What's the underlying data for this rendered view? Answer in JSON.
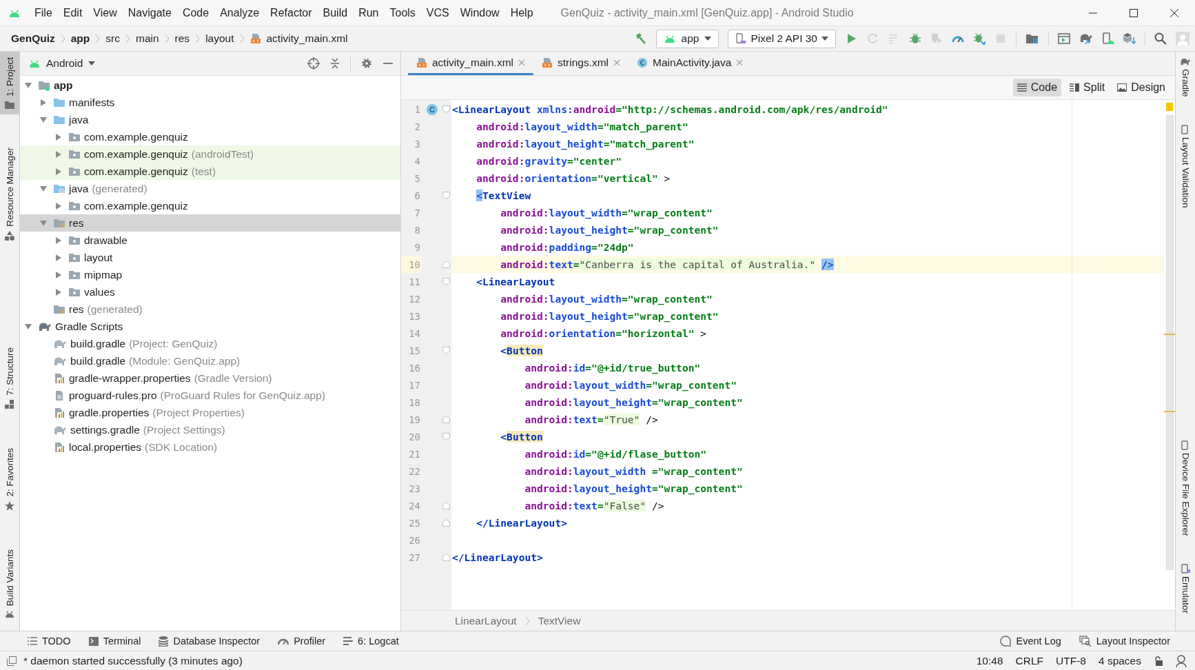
{
  "window": {
    "title": "GenQuiz - activity_main.xml [GenQuiz.app] - Android Studio"
  },
  "menu": [
    "File",
    "Edit",
    "View",
    "Navigate",
    "Code",
    "Analyze",
    "Refactor",
    "Build",
    "Run",
    "Tools",
    "VCS",
    "Window",
    "Help"
  ],
  "breadcrumbs": [
    {
      "label": "GenQuiz",
      "bold": true,
      "kind": "plain"
    },
    {
      "label": "app",
      "bold": true,
      "kind": "plain"
    },
    {
      "label": "src",
      "bold": false,
      "kind": "plain"
    },
    {
      "label": "main",
      "bold": false,
      "kind": "plain"
    },
    {
      "label": "res",
      "bold": false,
      "kind": "plain"
    },
    {
      "label": "layout",
      "bold": false,
      "kind": "plain"
    },
    {
      "label": "activity_main.xml",
      "bold": false,
      "kind": "xml"
    }
  ],
  "run_config": "app",
  "device": "Pixel 2 API 30",
  "toolbar_actions": [
    {
      "kind": "run",
      "disabled": false
    },
    {
      "kind": "rerun",
      "disabled": true
    },
    {
      "kind": "apply",
      "disabled": true
    },
    {
      "kind": "debug",
      "disabled": false
    },
    {
      "kind": "coverage",
      "disabled": true
    },
    {
      "kind": "profile",
      "disabled": false
    },
    {
      "kind": "attach",
      "disabled": false
    },
    {
      "kind": "stop",
      "disabled": true
    },
    {
      "kind": "structure",
      "disabled": false
    },
    {
      "kind": "layout",
      "disabled": false
    },
    {
      "kind": "sync",
      "disabled": false
    },
    {
      "kind": "avd",
      "disabled": false
    },
    {
      "kind": "sdk",
      "disabled": false
    }
  ],
  "left_stripe": {
    "top": [
      {
        "label": "1: Project",
        "selected": true,
        "kind": "folder"
      },
      {
        "label": "Resource Manager",
        "selected": false,
        "kind": "shapes"
      }
    ],
    "bottom": [
      {
        "label": "7: Structure",
        "selected": false,
        "kind": "structure"
      },
      {
        "label": "2: Favorites",
        "selected": false,
        "kind": "star"
      },
      {
        "label": "Build Variants",
        "selected": false,
        "kind": "android"
      }
    ]
  },
  "right_stripe": {
    "top": [
      {
        "label": "Gradle",
        "kind": "gradle"
      },
      {
        "label": "Layout Validation",
        "kind": "validation"
      }
    ],
    "bottom": [
      {
        "label": "Device File Explorer",
        "kind": "device"
      },
      {
        "label": "Emulator",
        "kind": "emulator"
      }
    ]
  },
  "project_panel": {
    "view": "Android",
    "tree": [
      {
        "label": "app",
        "kind": "module",
        "expanded": true,
        "selected": false,
        "children": [
          {
            "label": "manifests",
            "kind": "folder",
            "expanded": false,
            "selected": false
          },
          {
            "label": "java",
            "kind": "folder",
            "expanded": true,
            "selected": false,
            "children": [
              {
                "label": "com.example.genquiz",
                "kind": "package",
                "expanded": false,
                "selected": false,
                "test_source": false
              },
              {
                "label": "com.example.genquiz",
                "note": "(androidTest)",
                "kind": "package",
                "expanded": false,
                "selected": false,
                "test_source": true
              },
              {
                "label": "com.example.genquiz",
                "note": "(test)",
                "kind": "package",
                "expanded": false,
                "selected": false,
                "test_source": true
              }
            ]
          },
          {
            "label": "java",
            "note": "(generated)",
            "kind": "generated",
            "expanded": true,
            "selected": false,
            "children": [
              {
                "label": "com.example.genquiz",
                "kind": "package",
                "expanded": false,
                "selected": false,
                "test_source": false
              }
            ]
          },
          {
            "label": "res",
            "kind": "res",
            "expanded": true,
            "selected": true,
            "children": [
              {
                "label": "drawable",
                "kind": "package",
                "expanded": false,
                "selected": false
              },
              {
                "label": "layout",
                "kind": "package",
                "expanded": false,
                "selected": false
              },
              {
                "label": "mipmap",
                "kind": "package",
                "expanded": false,
                "selected": false
              },
              {
                "label": "values",
                "kind": "package",
                "expanded": false,
                "selected": false
              }
            ]
          },
          {
            "label": "res",
            "note": "(generated)",
            "kind": "res",
            "selected": false
          }
        ]
      },
      {
        "label": "Gradle Scripts",
        "kind": "gradle",
        "expanded": true,
        "selected": false,
        "children": [
          {
            "label": "build.gradle",
            "note": "(Project: GenQuiz)",
            "kind": "gradle-file",
            "selected": false
          },
          {
            "label": "build.gradle",
            "note": "(Module: GenQuiz.app)",
            "kind": "gradle-file",
            "selected": false
          },
          {
            "label": "gradle-wrapper.properties",
            "note": "(Gradle Version)",
            "kind": "properties",
            "selected": false
          },
          {
            "label": "proguard-rules.pro",
            "note": "(ProGuard Rules for GenQuiz.app)",
            "kind": "text-file",
            "selected": false
          },
          {
            "label": "gradle.properties",
            "note": "(Project Properties)",
            "kind": "properties",
            "selected": false
          },
          {
            "label": "settings.gradle",
            "note": "(Project Settings)",
            "kind": "gradle-file",
            "selected": false
          },
          {
            "label": "local.properties",
            "note": "(SDK Location)",
            "kind": "properties",
            "selected": false
          }
        ]
      }
    ]
  },
  "editor_tabs": [
    {
      "label": "activity_main.xml",
      "kind": "xml",
      "selected": true
    },
    {
      "label": "strings.xml",
      "kind": "xml",
      "selected": false
    },
    {
      "label": "MainActivity.java",
      "kind": "class",
      "selected": false
    }
  ],
  "view_modes": [
    {
      "label": "Code",
      "kind": "code",
      "selected": true
    },
    {
      "label": "Split",
      "kind": "split",
      "selected": false
    },
    {
      "label": "Design",
      "kind": "design",
      "selected": false
    }
  ],
  "code_lines": [
    {
      "number": "1",
      "current": false,
      "badge": "C",
      "fold_start": true,
      "tokens": [
        {
          "kind": "tag",
          "text": "<LinearLayout "
        },
        {
          "kind": "attr",
          "text": "xmlns:"
        },
        {
          "kind": "ns",
          "text": "android"
        },
        {
          "kind": "value",
          "text": "=\"http://schemas.android.com/apk/res/android\""
        }
      ]
    },
    {
      "number": "2",
      "current": false,
      "tokens": [
        {
          "kind": "ns",
          "text": "    android:"
        },
        {
          "kind": "attr",
          "text": "layout_width"
        },
        {
          "kind": "value",
          "text": "=\"match_parent\""
        }
      ]
    },
    {
      "number": "3",
      "current": false,
      "tokens": [
        {
          "kind": "ns",
          "text": "    android:"
        },
        {
          "kind": "attr",
          "text": "layout_height"
        },
        {
          "kind": "value",
          "text": "=\"match_parent\""
        }
      ]
    },
    {
      "number": "4",
      "current": false,
      "tokens": [
        {
          "kind": "ns",
          "text": "    android:"
        },
        {
          "kind": "attr",
          "text": "gravity"
        },
        {
          "kind": "value",
          "text": "=\"center\""
        }
      ]
    },
    {
      "number": "5",
      "current": false,
      "tokens": [
        {
          "kind": "ns",
          "text": "    android:"
        },
        {
          "kind": "attr",
          "text": "orientation"
        },
        {
          "kind": "value",
          "text": "=\"vertical\""
        },
        {
          "kind": "plain",
          "text": " >"
        }
      ]
    },
    {
      "number": "6",
      "current": false,
      "fold_start": true,
      "tokens": [
        {
          "kind": "bracket",
          "text": "    <"
        },
        {
          "kind": "tag",
          "text": "TextView"
        }
      ]
    },
    {
      "number": "7",
      "current": false,
      "tokens": [
        {
          "kind": "ns",
          "text": "        android:"
        },
        {
          "kind": "attr",
          "text": "layout_width"
        },
        {
          "kind": "value",
          "text": "=\"wrap_content\""
        }
      ]
    },
    {
      "number": "8",
      "current": false,
      "tokens": [
        {
          "kind": "ns",
          "text": "        android:"
        },
        {
          "kind": "attr",
          "text": "layout_height"
        },
        {
          "kind": "value",
          "text": "=\"wrap_content\""
        }
      ]
    },
    {
      "number": "9",
      "current": false,
      "tokens": [
        {
          "kind": "ns",
          "text": "        android:"
        },
        {
          "kind": "attr",
          "text": "padding"
        },
        {
          "kind": "value",
          "text": "=\"24dp\""
        }
      ]
    },
    {
      "number": "10",
      "current": true,
      "fold_end": true,
      "tokens": [
        {
          "kind": "ns",
          "text": "        android:"
        },
        {
          "kind": "attr",
          "text": "text"
        },
        {
          "kind": "value",
          "text": "="
        },
        {
          "kind": "literal",
          "text": "\"Canberra is the capital of Australia.\""
        },
        {
          "kind": "bracket",
          "text": " />"
        }
      ]
    },
    {
      "number": "11",
      "current": false,
      "fold_start": true,
      "tokens": [
        {
          "kind": "tag",
          "text": "    <LinearLayout"
        }
      ]
    },
    {
      "number": "12",
      "current": false,
      "tokens": [
        {
          "kind": "ns",
          "text": "        android:"
        },
        {
          "kind": "attr",
          "text": "layout_width"
        },
        {
          "kind": "value",
          "text": "=\"wrap_content\""
        }
      ]
    },
    {
      "number": "13",
      "current": false,
      "tokens": [
        {
          "kind": "ns",
          "text": "        android:"
        },
        {
          "kind": "attr",
          "text": "layout_height"
        },
        {
          "kind": "value",
          "text": "=\"wrap_content\""
        }
      ]
    },
    {
      "number": "14",
      "current": false,
      "tokens": [
        {
          "kind": "ns",
          "text": "        android:"
        },
        {
          "kind": "attr",
          "text": "orientation"
        },
        {
          "kind": "value",
          "text": "=\"horizontal\""
        },
        {
          "kind": "plain",
          "text": " >"
        }
      ]
    },
    {
      "number": "15",
      "current": false,
      "fold_start": true,
      "tokens": [
        {
          "kind": "tag",
          "text": "        <"
        },
        {
          "kind": "match",
          "text": "Button"
        }
      ]
    },
    {
      "number": "16",
      "current": false,
      "tokens": [
        {
          "kind": "ns",
          "text": "            android:"
        },
        {
          "kind": "attr",
          "text": "id"
        },
        {
          "kind": "value",
          "text": "=\"@+id/true_button\""
        }
      ]
    },
    {
      "number": "17",
      "current": false,
      "tokens": [
        {
          "kind": "ns",
          "text": "            android:"
        },
        {
          "kind": "attr",
          "text": "layout_width"
        },
        {
          "kind": "value",
          "text": "=\"wrap_content\""
        }
      ]
    },
    {
      "number": "18",
      "current": false,
      "tokens": [
        {
          "kind": "ns",
          "text": "            android:"
        },
        {
          "kind": "attr",
          "text": "layout_height"
        },
        {
          "kind": "value",
          "text": "=\"wrap_content\""
        }
      ]
    },
    {
      "number": "19",
      "current": false,
      "fold_end": true,
      "tokens": [
        {
          "kind": "ns",
          "text": "            android:"
        },
        {
          "kind": "attr",
          "text": "text"
        },
        {
          "kind": "value",
          "text": "="
        },
        {
          "kind": "literal",
          "text": "\"True\""
        },
        {
          "kind": "plain",
          "text": " />"
        }
      ]
    },
    {
      "number": "20",
      "current": false,
      "fold_start": true,
      "tokens": [
        {
          "kind": "tag",
          "text": "        <"
        },
        {
          "kind": "match",
          "text": "Button"
        }
      ]
    },
    {
      "number": "21",
      "current": false,
      "tokens": [
        {
          "kind": "ns",
          "text": "            android:"
        },
        {
          "kind": "attr",
          "text": "id"
        },
        {
          "kind": "value",
          "text": "=\"@+id/flase_button\""
        }
      ]
    },
    {
      "number": "22",
      "current": false,
      "tokens": [
        {
          "kind": "ns",
          "text": "            android:"
        },
        {
          "kind": "attr",
          "text": "layout_width "
        },
        {
          "kind": "value",
          "text": "=\"wrap_content\""
        }
      ]
    },
    {
      "number": "23",
      "current": false,
      "tokens": [
        {
          "kind": "ns",
          "text": "            android:"
        },
        {
          "kind": "attr",
          "text": "layout_height"
        },
        {
          "kind": "value",
          "text": "=\"wrap_content\""
        }
      ]
    },
    {
      "number": "24",
      "current": false,
      "fold_end": true,
      "tokens": [
        {
          "kind": "ns",
          "text": "            android:"
        },
        {
          "kind": "attr",
          "text": "text"
        },
        {
          "kind": "value",
          "text": "="
        },
        {
          "kind": "literal",
          "text": "\"False\""
        },
        {
          "kind": "plain",
          "text": " />"
        }
      ]
    },
    {
      "number": "25",
      "current": false,
      "fold_end": true,
      "tokens": [
        {
          "kind": "tag",
          "text": "    </LinearLayout>"
        }
      ]
    },
    {
      "number": "26",
      "current": false
    },
    {
      "number": "27",
      "current": false,
      "fold_end": true,
      "tokens": [
        {
          "kind": "tag",
          "text": "</LinearLayout>"
        }
      ]
    }
  ],
  "editor_breadcrumbs": [
    "LinearLayout",
    "TextView"
  ],
  "tool_windows": {
    "left": [
      {
        "label": "TODO",
        "kind": "list"
      },
      {
        "label": "Terminal",
        "kind": "terminal"
      },
      {
        "label": "Database Inspector",
        "kind": "database"
      },
      {
        "label": "Profiler",
        "kind": "gauge"
      },
      {
        "label": "6: Logcat",
        "kind": "lines"
      }
    ],
    "right": [
      {
        "label": "Event Log",
        "kind": "bubble"
      },
      {
        "label": "Layout Inspector",
        "kind": "inspect"
      }
    ]
  },
  "status_bar": {
    "message": "* daemon started successfully (3 minutes ago)",
    "position": "10:48",
    "line_separator": "CRLF",
    "encoding": "UTF-8",
    "indent": "4 spaces"
  }
}
